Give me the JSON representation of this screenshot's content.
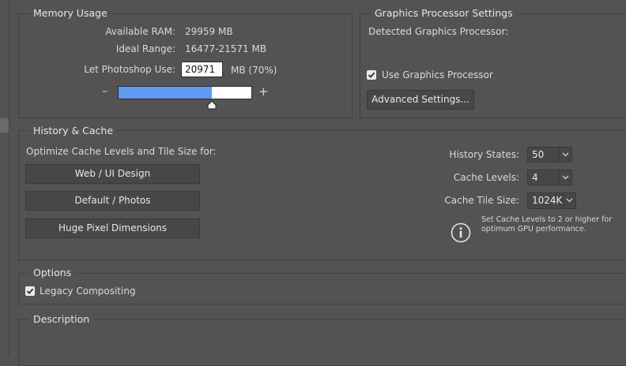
{
  "memory": {
    "legend": "Memory Usage",
    "available_ram_label": "Available RAM:",
    "available_ram_value": "29959 MB",
    "ideal_range_label": "Ideal Range:",
    "ideal_range_value": "16477-21571 MB",
    "let_use_label": "Let Photoshop Use:",
    "let_use_value": "20971",
    "let_use_unit": "MB (70%)",
    "minus": "–",
    "plus": "+",
    "slider_fraction": 0.7,
    "slider_fill_color": "#5f9cf1"
  },
  "gpu": {
    "legend": "Graphics Processor Settings",
    "detected_label": "Detected Graphics Processor:",
    "use_gpu_label": "Use Graphics Processor",
    "use_gpu_checked": true,
    "advanced_button": "Advanced Settings..."
  },
  "history_cache": {
    "legend": "History & Cache",
    "optimize_label": "Optimize Cache Levels and Tile Size for:",
    "preset_buttons": [
      "Web / UI Design",
      "Default / Photos",
      "Huge Pixel Dimensions"
    ],
    "history_states_label": "History States:",
    "history_states_value": "50",
    "cache_levels_label": "Cache Levels:",
    "cache_levels_value": "4",
    "cache_tile_label": "Cache Tile Size:",
    "cache_tile_value": "1024K",
    "info_line1": "Set Cache Levels to 2 or higher for",
    "info_line2": "optimum GPU performance.",
    "info_icon": "info-circle-icon"
  },
  "options": {
    "legend": "Options",
    "legacy_label": "Legacy Compositing",
    "legacy_checked": true
  },
  "description": {
    "legend": "Description"
  }
}
